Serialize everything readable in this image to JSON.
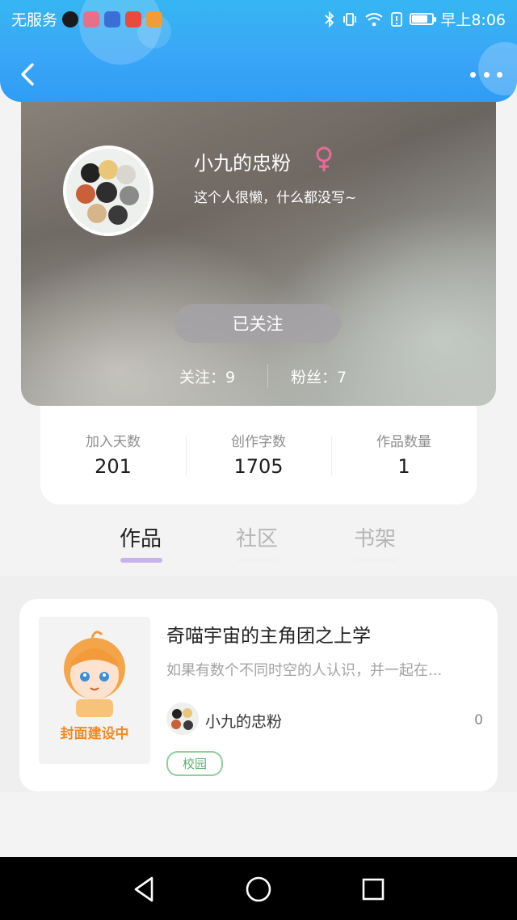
{
  "status_bar": {
    "carrier": "无服务",
    "time": "早上8:06",
    "battery_level": 0.8
  },
  "header": {
    "back_icon": "chevron-left-icon",
    "more_icon": "more-horizontal-icon"
  },
  "profile": {
    "username": "小九的忠粉",
    "bio": "这个人很懒，什么都没写~",
    "gender_icon": "female-icon",
    "follow_button": "已关注",
    "following_label": "关注：9",
    "fans_label": "粉丝：7"
  },
  "stats": [
    {
      "label": "加入天数",
      "value": "201"
    },
    {
      "label": "创作字数",
      "value": "1705"
    },
    {
      "label": "作品数量",
      "value": "1"
    }
  ],
  "tabs": [
    {
      "label": "作品",
      "active": true
    },
    {
      "label": "社区",
      "active": false
    },
    {
      "label": "书架",
      "active": false
    }
  ],
  "works": [
    {
      "cover_text": "封面建设中",
      "title": "奇喵宇宙的主角团之上学",
      "description": "如果有数个不同时空的人认识，并一起在...",
      "author": "小九的忠粉",
      "count": "0",
      "tag": "校园"
    }
  ],
  "colors": {
    "header_blue": "#3aa6f7",
    "tab_indicator": "#c9b1ec",
    "tag_green": "#5cb06a",
    "cover_orange": "#f08a25"
  }
}
